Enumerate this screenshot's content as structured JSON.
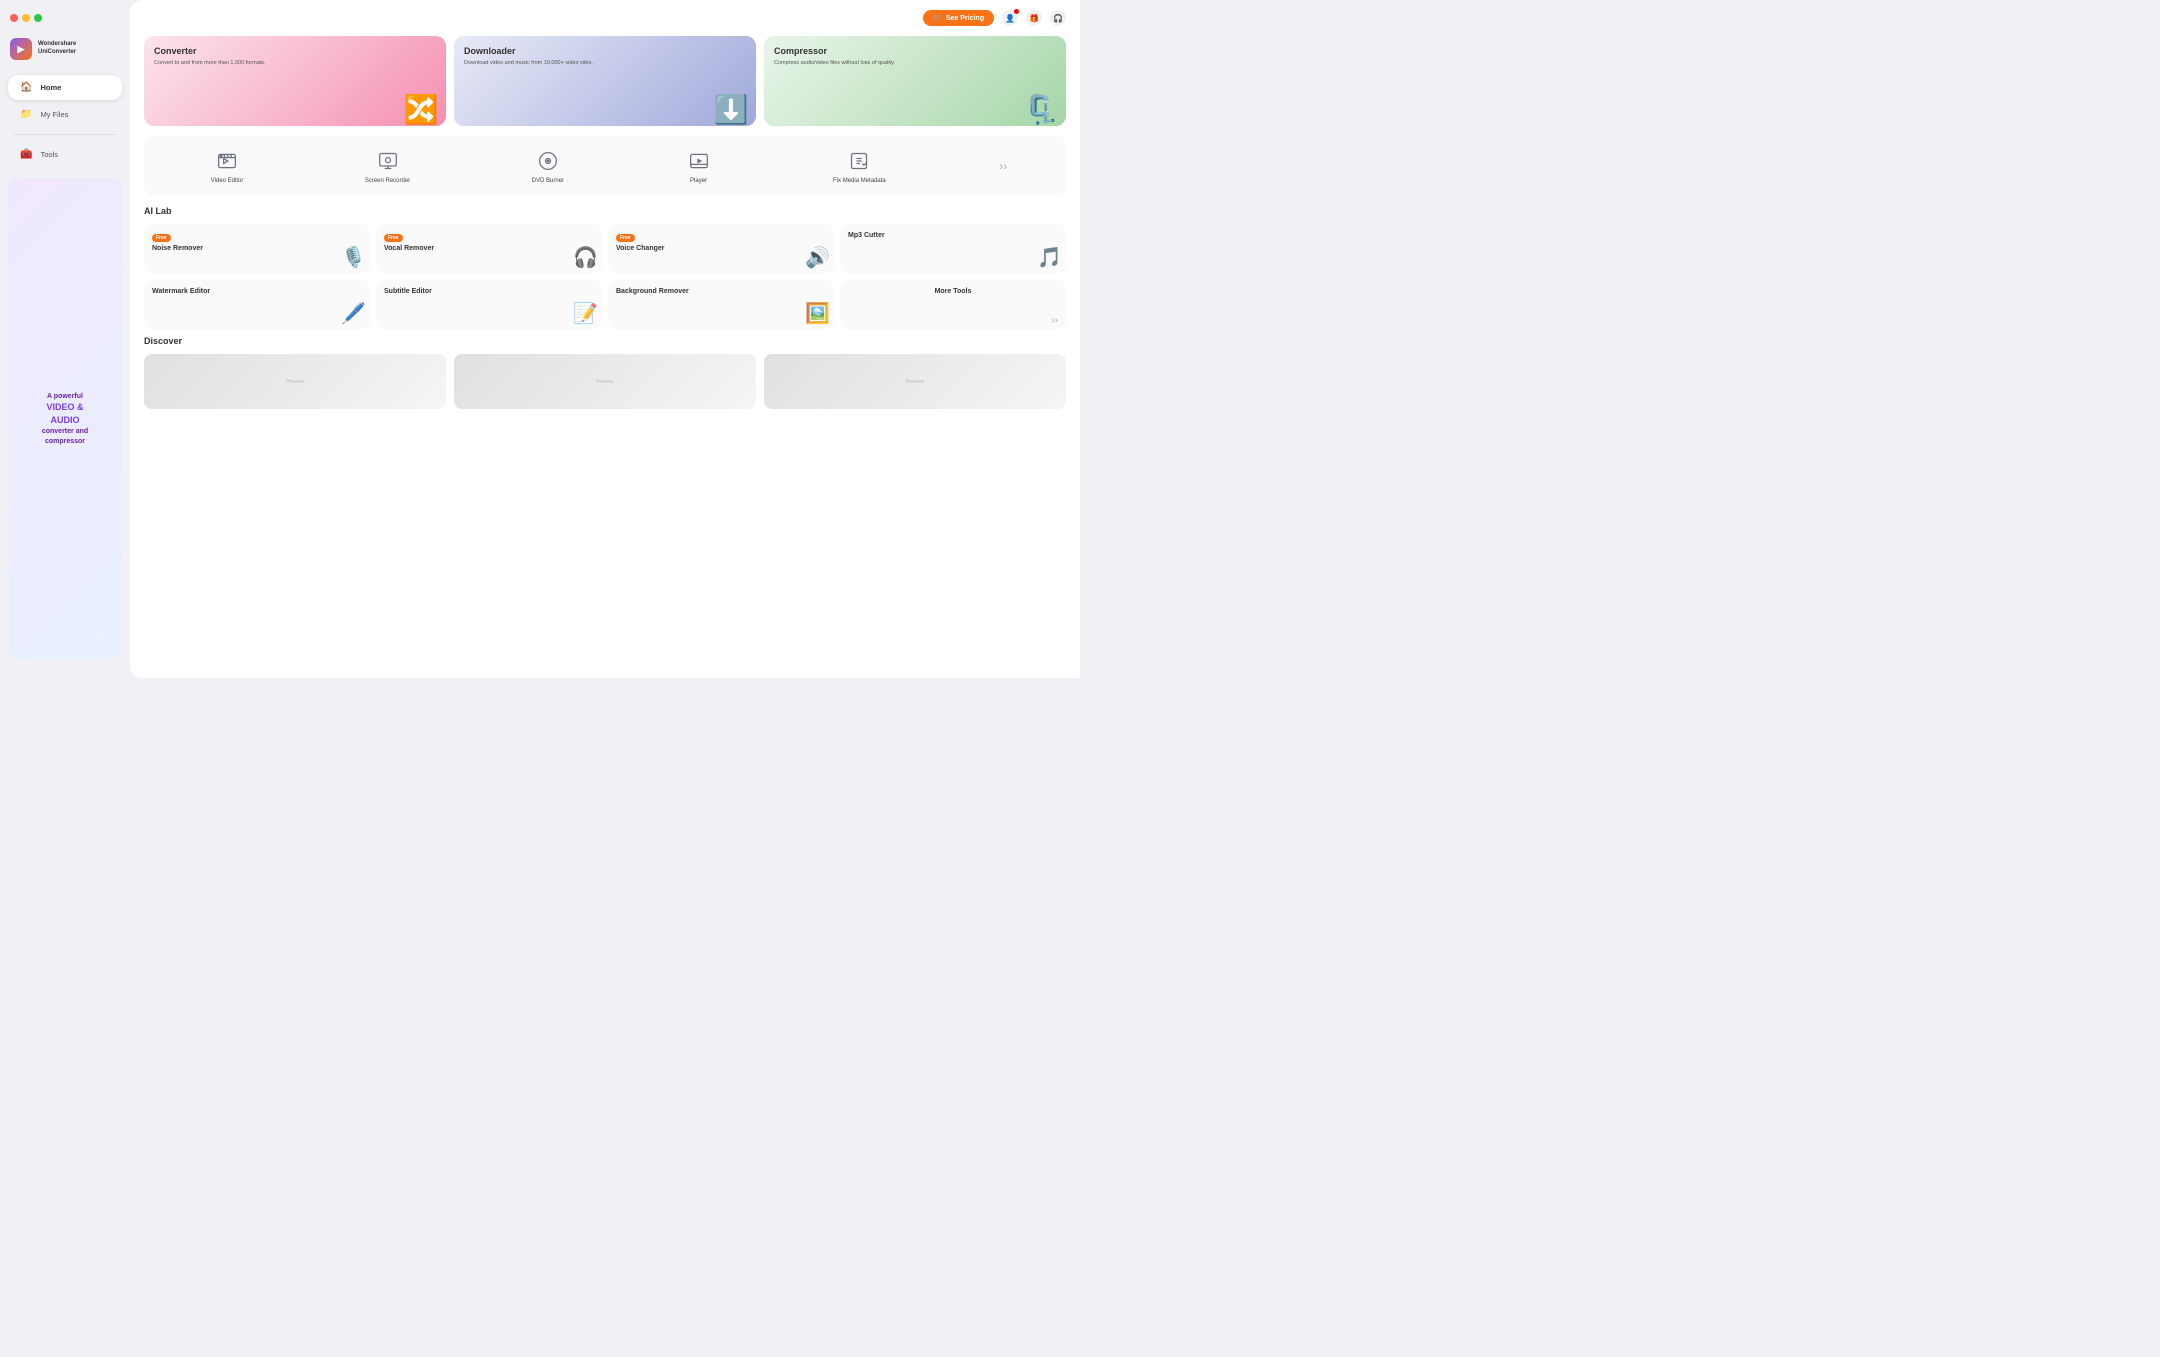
{
  "window": {
    "traffic_lights": [
      "red",
      "yellow",
      "green"
    ]
  },
  "app": {
    "logo_line1": "Wondershare",
    "logo_line2": "UniConverter"
  },
  "sidebar": {
    "items": [
      {
        "id": "home",
        "label": "Home",
        "icon": "🏠",
        "active": true
      },
      {
        "id": "myfiles",
        "label": "My Files",
        "icon": "📁",
        "active": false
      }
    ],
    "tools_item": {
      "label": "Tools",
      "icon": "🧰"
    },
    "banner": {
      "line1": "A powerful",
      "line2": "VIDEO &",
      "line3": "AUDIO",
      "line4": "converter and",
      "line5": "compressor"
    }
  },
  "header": {
    "see_pricing_label": "See Pricing",
    "see_pricing_icon": "🛒"
  },
  "feature_cards": [
    {
      "id": "converter",
      "title": "Converter",
      "description": "Convert to and from more than 1,000 formats.",
      "icon": "🔀"
    },
    {
      "id": "downloader",
      "title": "Downloader",
      "description": "Download video and music from 10,000+ video sites.",
      "icon": "⬇️"
    },
    {
      "id": "compressor",
      "title": "Compressor",
      "description": "Compress audio/video files without loss of quality.",
      "icon": "🗜️"
    }
  ],
  "tools": [
    {
      "id": "video-editor",
      "label": "Video Editor",
      "icon": "✂"
    },
    {
      "id": "screen-recorder",
      "label": "Screen Recorder",
      "icon": "🖥"
    },
    {
      "id": "dvd-burner",
      "label": "DVD Burner",
      "icon": "💿"
    },
    {
      "id": "player",
      "label": "Player",
      "icon": "▶"
    },
    {
      "id": "fix-media",
      "label": "Fix Media Metadata",
      "icon": "🔧"
    }
  ],
  "ai_lab": {
    "title": "AI Lab",
    "row1": [
      {
        "id": "noise-remover",
        "label": "Noise Remover",
        "free": true,
        "icon": "🎙"
      },
      {
        "id": "vocal-remover",
        "label": "Vocal Remover",
        "free": true,
        "icon": "🎧"
      },
      {
        "id": "voice-changer",
        "label": "Voice Changer",
        "free": true,
        "icon": "🔊"
      },
      {
        "id": "mp3-cutter",
        "label": "Mp3 Cutter",
        "free": false,
        "icon": "✂"
      }
    ],
    "row2": [
      {
        "id": "watermark-editor",
        "label": "Watermark Editor",
        "free": false,
        "icon": "🖊"
      },
      {
        "id": "subtitle-editor",
        "label": "Subtitle Editor",
        "free": false,
        "icon": "📝"
      },
      {
        "id": "background-remover",
        "label": "Background Remover",
        "free": false,
        "icon": "🖼"
      },
      {
        "id": "more-tools",
        "label": "More Tools",
        "free": false,
        "icon": "›"
      }
    ],
    "free_label": "Free"
  },
  "discover": {
    "title": "Discover"
  }
}
